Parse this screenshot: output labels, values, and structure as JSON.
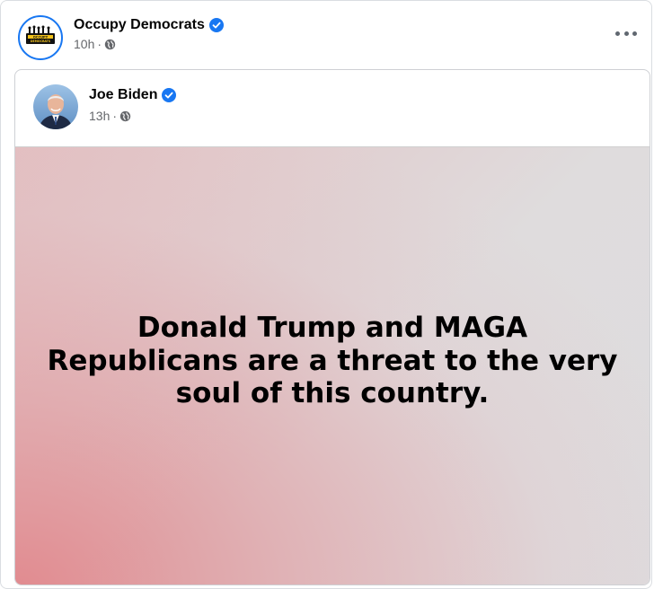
{
  "post": {
    "author": "Occupy Democrats",
    "time": "10h",
    "separator": "·",
    "logo_text_top": "OCCUPY",
    "logo_text_bottom": "DEMOCRATS",
    "more_icon": "more-horizontal-icon"
  },
  "shared": {
    "author": "Joe Biden",
    "time": "13h",
    "separator": "·",
    "quote": "Donald Trump and MAGA Republicans are a threat to the very soul of this country."
  },
  "colors": {
    "verified": "#1877f2",
    "meta_text": "#65676b",
    "avatar_ring": "#1877f2"
  }
}
